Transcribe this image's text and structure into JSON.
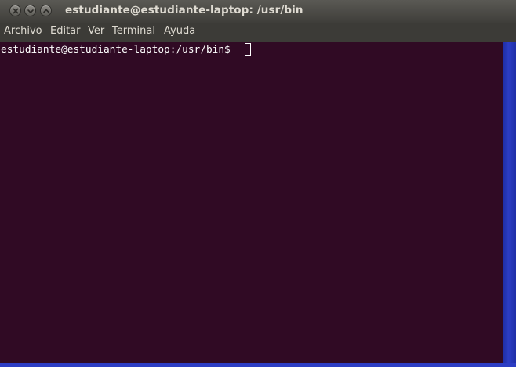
{
  "window": {
    "title": "estudiante@estudiante-laptop: /usr/bin"
  },
  "menu": {
    "items": [
      {
        "label": "Archivo"
      },
      {
        "label": "Editar"
      },
      {
        "label": "Ver"
      },
      {
        "label": "Terminal"
      },
      {
        "label": "Ayuda"
      }
    ]
  },
  "terminal": {
    "prompt": "estudiante@estudiante-laptop:/usr/bin$ ",
    "background_color": "#300a24",
    "text_color": "#ffffff"
  },
  "icons": [
    "close-icon",
    "minimize-icon",
    "maximize-icon"
  ]
}
